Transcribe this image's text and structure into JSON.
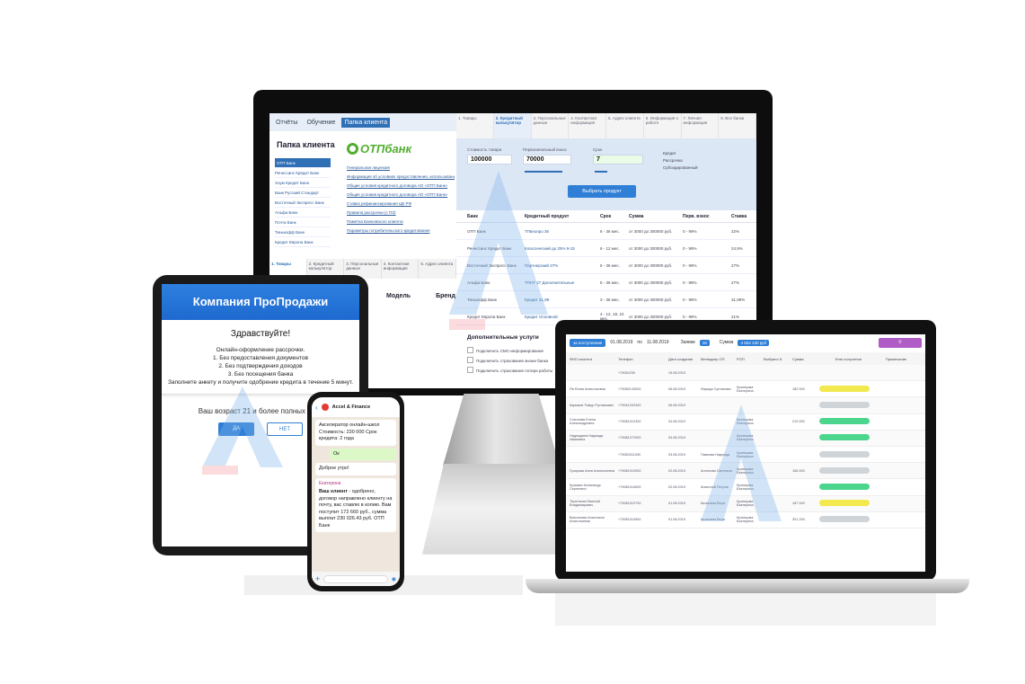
{
  "desktop": {
    "nav": [
      "Отчёты",
      "Обучение",
      "Папка клиента"
    ],
    "folder_title": "Папка клиента",
    "brand": "ОТПбанк",
    "banks": [
      "ОТП Банк",
      "Ренессанс Кредит Банк",
      "Хоум Кредит Банк",
      "Банк Русский Стандарт",
      "Восточный Экспресс Банк",
      "Альфа Банк",
      "Почта Банк",
      "Тинькофф Банк",
      "Кредит Европа Банк"
    ],
    "documents": [
      "Генеральная лицензия",
      "Информация об условиях предоставления, использования",
      "Общие условия кредитного договора АО «ОТП Банк»",
      "Общие условия кредитного договора АО «ОТП Банк»",
      "Ставка рефинансирования ЦБ РФ",
      "Правила рассрочки (с ПЗ)",
      "Памятка Банковского клиента",
      "Параметры потребительского кредитования"
    ],
    "bottom_tabs": [
      "1. Товары",
      "2. Кредитный калькулятор",
      "3. Персональные данные",
      "4. Контактная информация",
      "5. Адрес клиента"
    ],
    "field_labels": [
      "Модель",
      "Бренд"
    ],
    "steps": [
      "1. Товары",
      "2. Кредитный калькулятор",
      "3. Персональные данные",
      "4. Контактная информация",
      "5. Адрес клиента",
      "6. Информация о работе",
      "7. Личная информация",
      "8. Все банки"
    ],
    "calc": {
      "price_label": "Стоимость товара",
      "price_value": "100000",
      "down_label": "Первоначальный взнос",
      "down_value": "70000",
      "term_label": "Срок",
      "term_value": "7",
      "radio_options": [
        "Кредит",
        "Рассрочка",
        "Субсидированный"
      ],
      "pick_button": "Выбрать продукт"
    },
    "table_headers": [
      "Банк",
      "Кредитный продукт",
      "Срок",
      "Сумма",
      "Перв. взнос",
      "Ставка"
    ],
    "table_rows": [
      [
        "ОТП Банк",
        "ТПвнопро 36",
        "6 - 36 мес.",
        "от 3000 до 300000 руб.",
        "0 - 99%",
        "22%"
      ],
      [
        "Ренессанс Кредит Банк",
        "Классический до 25% 9-15",
        "6 - 12 мес.",
        "от 3000 до 300000 руб.",
        "0 - 99%",
        "24,9%"
      ],
      [
        "Восточный Экспресс Банк",
        "Партнерский 27%",
        "6 - 36 мес.",
        "от 3000 до 300000 руб.",
        "0 - 99%",
        "27%"
      ],
      [
        "Альфа Банк",
        "ТПНТ 27 Дополнительные",
        "6 - 36 мес.",
        "от 3000 до 300000 руб.",
        "0 - 99%",
        "27%"
      ],
      [
        "Тинькофф Банк",
        "Кредит 31,99",
        "3 - 36 мес.",
        "от 3000 до 300000 руб.",
        "0 - 99%",
        "31,99%"
      ],
      [
        "Кредит Европа Банк",
        "Кредит Основной",
        "4 - 12, 18, 24 мес.",
        "от 3000 до 300000 руб.",
        "0 - 99%",
        "21%"
      ]
    ],
    "extra_title": "Дополнительные услуги",
    "extra_items": [
      "Подключить СМС-информирование",
      "Подключить страхование жизни банка",
      "Подключить страхование потери работы"
    ]
  },
  "laptop": {
    "top_button": "за поступления",
    "date_from": "01.08.2019",
    "date_sep": "по",
    "date_to": "11.08.2019",
    "orders_label": "Заявки",
    "orders_count": "18",
    "sum_label": "Сумма",
    "sum_value": "4 504 130 руб",
    "headers": [
      "ФИО клиента",
      "Телефон",
      "Дата создания",
      "Менеджер ОП",
      "РОП",
      "Выбрано б.",
      "Сумма",
      "Этап получения",
      "Примечание"
    ],
    "rows": [
      [
        "",
        "+79052230",
        "19.08.2019",
        "",
        "",
        "",
        "",
        "",
        ""
      ],
      [
        "Ян Юлия Анатольевна",
        "+79082143000",
        "06.08.2019",
        "Фарида Султанова",
        "Кузнецова Екатерина",
        "",
        "182 000",
        "yellow",
        ""
      ],
      [
        "Каримов Тимур Рустамович",
        "+79041202300",
        "06.08.2019",
        "",
        "",
        "",
        "",
        "gray",
        ""
      ],
      [
        "Соколова Елена Александровна",
        "+79081012300",
        "04.08.2019",
        "",
        "Кузнецова Екатерина",
        "",
        "210 000",
        "green",
        ""
      ],
      [
        "Надеждина Надежда Ивановна",
        "+79081272900",
        "04.08.2019",
        "",
        "Кузнецова Екатерина",
        "",
        "",
        "green",
        ""
      ],
      [
        "",
        "+79052011000",
        "03.08.2019",
        "Павлова Надежда",
        "Кузнецова Екатерина",
        "",
        "",
        "gray",
        ""
      ],
      [
        "Гусарова Анна Анатольевна",
        "+79081010900",
        "02.08.2019",
        "Антонова Светлана",
        "Кузнецова Екатерина",
        "",
        "156 000",
        "gray",
        ""
      ],
      [
        "Кузьмин Александр Сергеевич",
        "+79081014000",
        "02.08.2019",
        "Анатолий Петров",
        "Кузнецова Екатерина",
        "",
        "",
        "green",
        ""
      ],
      [
        "Терентьев Евгений Владимирович",
        "+79081012700",
        "01.08.2019",
        "Калинина Вера",
        "Кузнецова Екатерина",
        "",
        "187 000",
        "yellow",
        ""
      ],
      [
        "Васильева Анастасия Анатольевна",
        "+79081014500",
        "01.08.2019",
        "Калинина Вера",
        "Кузнецова Екатерина",
        "",
        "301 250",
        "gray",
        ""
      ]
    ]
  },
  "tablet": {
    "title": "Компания ПроПродажи",
    "hello": "Здравствуйте!",
    "lines": [
      "Онлайн-оформление рассрочки.",
      "1. Без предоставления документов",
      "2. Без подтверждения доходов",
      "3. Без посещения банка",
      "Заполните анкету и получите одобрение кредита в течение 5 минут."
    ],
    "age_question": "Ваш возраст 21 и более полных лет?",
    "yes": "ДА",
    "no": "НЕТ"
  },
  "phone": {
    "chat_name": "Accel & Finance",
    "msg1": "Акселератор онлайн-школ Стоимость: 230 000 Срок кредита: 2 года",
    "msg2": "Ок",
    "msg3": "Доброе утро!",
    "sender": "Екатерина",
    "msg4_bold": "Ваш клиент",
    "msg4": " - одобрено, договор направлено клиенту на почту, вас ставлю в копию. Вам поступит 172 660 руб., сумма выплат 230 026.43 руб. ОТП Банк"
  },
  "colors": {
    "accent": "#2f7fd6",
    "otp_green": "#52ae30",
    "chip_yellow": "#f2e94e",
    "chip_green": "#4cd68d",
    "chip_gray": "#cfd4d9",
    "filter_purple": "#b05cc6"
  }
}
